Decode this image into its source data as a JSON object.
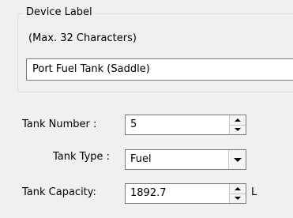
{
  "device_label_group": {
    "title": "Device Label",
    "hint": "(Max. 32 Characters)",
    "value": "Port Fuel Tank (Saddle)"
  },
  "tank_number": {
    "label": "Tank Number :",
    "value": "5"
  },
  "tank_type": {
    "label": "Tank Type :",
    "value": "Fuel"
  },
  "tank_capacity": {
    "label": "Tank Capacity:",
    "value": "1892.7",
    "unit": "L"
  }
}
